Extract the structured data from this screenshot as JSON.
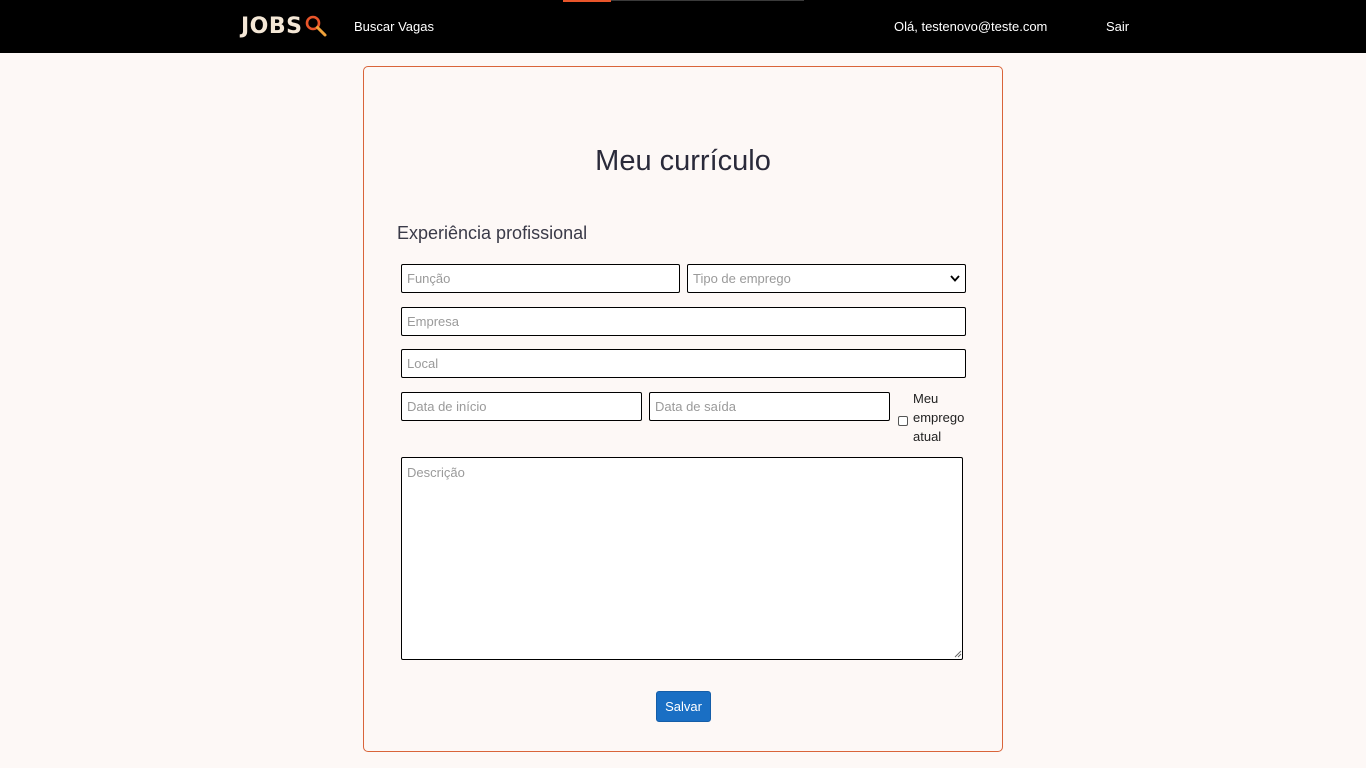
{
  "navbar": {
    "logo_text": "JOBS",
    "logo_icon": "magnifier-icon",
    "search_link": "Buscar Vagas",
    "user_greeting": "Olá, testenovo@teste.com",
    "logout_link": "Sair",
    "loading_progress": 0.2
  },
  "form": {
    "title": "Meu currículo",
    "section_title": "Experiência profissional",
    "funcao_placeholder": "Função",
    "tipo_emprego_selected": "Tipo de emprego",
    "empresa_placeholder": "Empresa",
    "local_placeholder": "Local",
    "data_inicio_placeholder": "Data de início",
    "data_saida_placeholder": "Data de saída",
    "current_job_label": "Meu emprego atual",
    "current_job_checked": false,
    "descricao_placeholder": "Descrição",
    "save_label": "Salvar"
  },
  "colors": {
    "accent": "#e8552a",
    "card_border": "#d9643a",
    "button": "#1a6fc4",
    "background": "#fdf8f6"
  }
}
